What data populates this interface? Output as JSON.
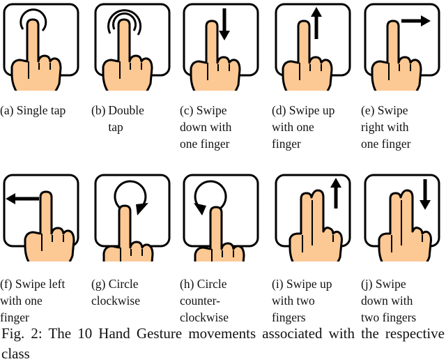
{
  "figure": {
    "panels": [
      {
        "id": "a",
        "label": "(a)",
        "lines": [
          "Single tap"
        ],
        "gesture": "single-tap",
        "fingers": 1
      },
      {
        "id": "b",
        "label": "(b)",
        "lines": [
          "Double",
          "tap"
        ],
        "gesture": "double-tap",
        "fingers": 1
      },
      {
        "id": "c",
        "label": "(c)",
        "lines": [
          "Swipe",
          "down with",
          "one finger"
        ],
        "gesture": "swipe-down",
        "fingers": 1
      },
      {
        "id": "d",
        "label": "(d)",
        "lines": [
          "Swipe up",
          "with one",
          "finger"
        ],
        "gesture": "swipe-up",
        "fingers": 1
      },
      {
        "id": "e",
        "label": "(e)",
        "lines": [
          "Swipe",
          "right with",
          "one finger"
        ],
        "gesture": "swipe-right",
        "fingers": 1
      },
      {
        "id": "f",
        "label": "(f)",
        "lines": [
          "Swipe left",
          "with one",
          "finger"
        ],
        "gesture": "swipe-left",
        "fingers": 1
      },
      {
        "id": "g",
        "label": "(g)",
        "lines": [
          "Circle",
          "clockwise"
        ],
        "gesture": "circle-clockwise",
        "fingers": 1
      },
      {
        "id": "h",
        "label": "(h)",
        "lines": [
          "Circle",
          "counter-",
          "clockwise"
        ],
        "gesture": "circle-counterclockwise",
        "fingers": 1
      },
      {
        "id": "i",
        "label": "(i)",
        "lines": [
          "Swipe up",
          "with two",
          "fingers"
        ],
        "gesture": "swipe-up",
        "fingers": 2
      },
      {
        "id": "j",
        "label": "(j)",
        "lines": [
          "Swipe",
          "down with",
          "two fingers"
        ],
        "gesture": "swipe-down",
        "fingers": 2
      }
    ],
    "caption": "Fig. 2: The 10 Hand Gesture movements associated with the respective class"
  },
  "colors": {
    "skin": "#fcc893",
    "outline": "#000000",
    "background": "#ffffff"
  }
}
